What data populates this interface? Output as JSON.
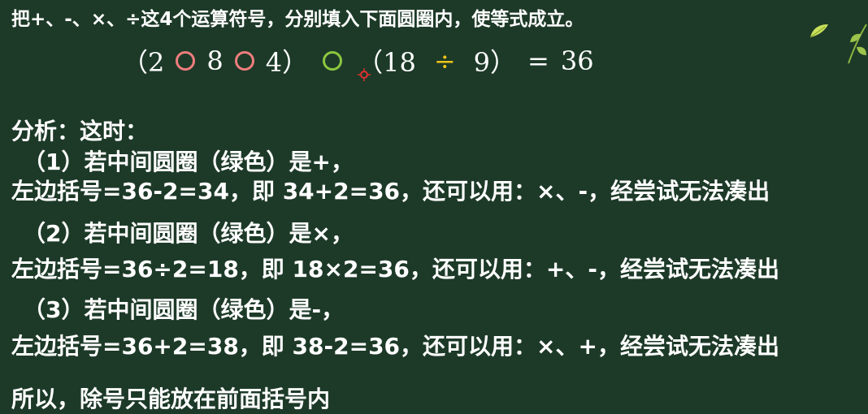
{
  "instruction": "把+、-、×、÷这4个运算符号，分别填入下面圆圈内，使等式成立。",
  "equation": {
    "open_paren_1": "（2",
    "num_8": "8",
    "num_4_close": "4）",
    "open_paren_2": "（18",
    "divide": "÷",
    "num_9_close": "9）",
    "equals": "=",
    "result": "36"
  },
  "analysis": {
    "heading": "分析：这时：",
    "case1_title": "（1）若中间圆圈（绿色）是+，",
    "case1_body": "左边括号=36-2=34，即 34+2=36，还可以用：×、-，经尝试无法凑出",
    "case2_title": "（2）若中间圆圈（绿色）是×，",
    "case2_body": "左边括号=36÷2=18，即 18×2=36，还可以用：+、-，经尝试无法凑出",
    "case3_title": "（3）若中间圆圈（绿色）是-，",
    "case3_body": "左边括号=36+2=38，即 38-2=36，还可以用：×、+，经尝试无法凑出",
    "conclusion": "所以，除号只能放在前面括号内"
  },
  "colors": {
    "background": "#1d3a28",
    "circle_pink": "#f07d7d",
    "circle_green": "#8cc73f",
    "divide_yellow": "#f0c419",
    "cursor_red": "#e03030"
  }
}
